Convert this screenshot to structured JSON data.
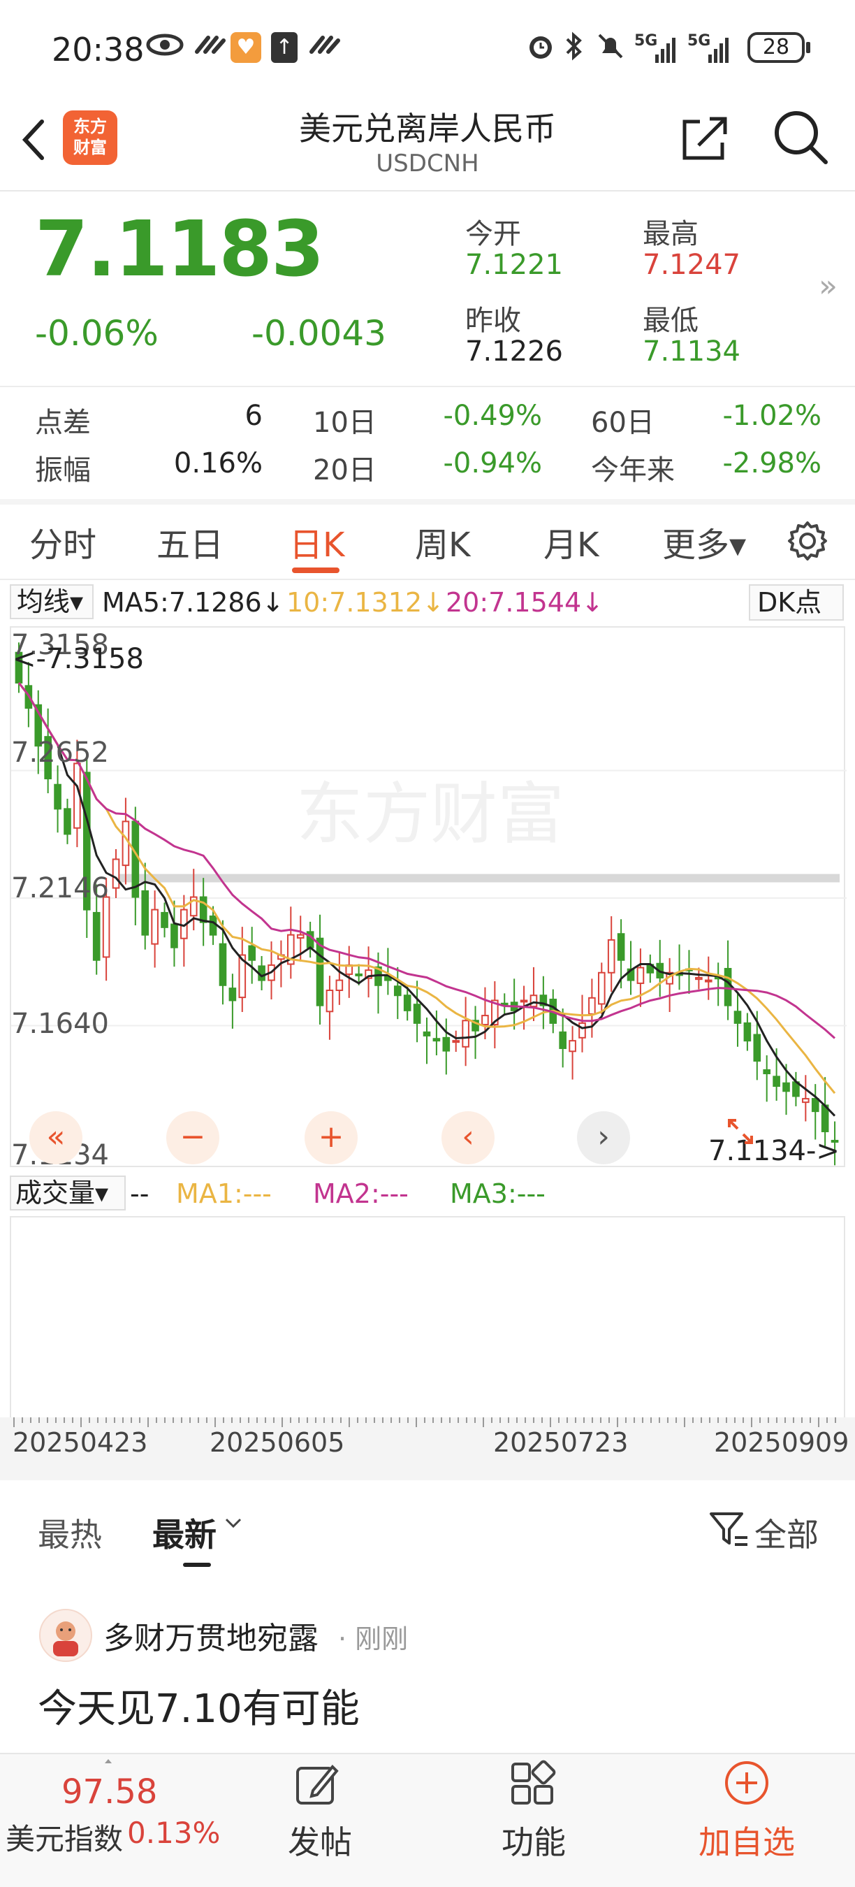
{
  "status_bar": {
    "time": "20:38",
    "battery": "28",
    "signal_left": "5G",
    "signal_right": "5G"
  },
  "header": {
    "back_icon": "chevron-left-icon",
    "logo_text_line1": "东方",
    "logo_text_line2": "财富",
    "title": "美元兑离岸人民币",
    "subtitle": "USDCNH"
  },
  "quote": {
    "price": "7.1183",
    "change_pct": "-0.06%",
    "change_abs": "-0.0043",
    "open_label": "今开",
    "open": "7.1221",
    "high_label": "最高",
    "high": "7.1247",
    "prev_close_label": "昨收",
    "prev_close": "7.1226",
    "low_label": "最低",
    "low": "7.1134"
  },
  "stats": {
    "spread_label": "点差",
    "spread": "6",
    "d10_label": "10日",
    "d10": "-0.49%",
    "d60_label": "60日",
    "d60": "-1.02%",
    "amplitude_label": "振幅",
    "amplitude": "0.16%",
    "d20_label": "20日",
    "d20": "-0.94%",
    "ytd_label": "今年来",
    "ytd": "-2.98%"
  },
  "tabs": [
    {
      "label": "分时",
      "active": false
    },
    {
      "label": "五日",
      "active": false
    },
    {
      "label": "日K",
      "active": true
    },
    {
      "label": "周K",
      "active": false
    },
    {
      "label": "月K",
      "active": false
    },
    {
      "label": "更多▾",
      "active": false
    }
  ],
  "ma_legend": {
    "selector": "均线▾",
    "ma5": "MA5:7.1286↓",
    "ma10": "10:7.1312↓",
    "ma20": "20:7.1544↓",
    "dk": "DK点"
  },
  "colors": {
    "up": "#d9433b",
    "down": "#3a9a2a",
    "ma5": "#222222",
    "ma10": "#eab543",
    "ma20": "#c2348f",
    "accent": "#e8542d"
  },
  "chart_data": {
    "type": "candlestick",
    "y_ticks": [
      "7.3158",
      "7.2652",
      "7.2146",
      "7.1640",
      "7.1134"
    ],
    "ylim": [
      7.1134,
      7.3158
    ],
    "high_marker": "<-7.3158",
    "low_marker": "7.1134->",
    "watermark": "东方财富",
    "x_ticks": [
      "20250423",
      "20250605",
      "20250723",
      "20250909"
    ],
    "ma_lines": [
      "MA5",
      "MA10",
      "MA20"
    ],
    "close": [
      7.3,
      7.29,
      7.275,
      7.262,
      7.25,
      7.24,
      7.268,
      7.21,
      7.19,
      7.215,
      7.23,
      7.245,
      7.215,
      7.2,
      7.21,
      7.203,
      7.195,
      7.21,
      7.215,
      7.205,
      7.2,
      7.18,
      7.174,
      7.192,
      7.19,
      7.182,
      7.188,
      7.192,
      7.2,
      7.2,
      7.195,
      7.172,
      7.178,
      7.182,
      7.188,
      7.184,
      7.186,
      7.18,
      7.182,
      7.176,
      7.17,
      7.165,
      7.16,
      7.158,
      7.154,
      7.158,
      7.166,
      7.162,
      7.168,
      7.174,
      7.172,
      7.17,
      7.174,
      7.176,
      7.172,
      7.165,
      7.155,
      7.158,
      7.165,
      7.175,
      7.185,
      7.198,
      7.19,
      7.182,
      7.187,
      7.185,
      7.183,
      7.185,
      7.184,
      7.186,
      7.183,
      7.182,
      7.183,
      7.172,
      7.165,
      7.158,
      7.15,
      7.145,
      7.14,
      7.138,
      7.136,
      7.135,
      7.13,
      7.122,
      7.118
    ]
  },
  "chart_nav": {
    "rewind": "«",
    "zoom_out": "−",
    "zoom_in": "+",
    "prev": "‹",
    "next": "›"
  },
  "volume": {
    "selector": "成交量▾",
    "dash": "--",
    "ma1": "MA1:---",
    "ma2": "MA2:---",
    "ma3": "MA3:---"
  },
  "feed": {
    "tab_hot": "最热",
    "tab_new": "最新",
    "filter_label": "全部",
    "post_user": "多财万贯地宛露",
    "post_time": "· 刚刚",
    "post_text": "今天见7.10有可能"
  },
  "bottom_bar": {
    "index_value": "97.58",
    "index_name": "美元指数",
    "index_change": "0.13%",
    "post": "发帖",
    "functions": "功能",
    "add_watch": "加自选"
  }
}
